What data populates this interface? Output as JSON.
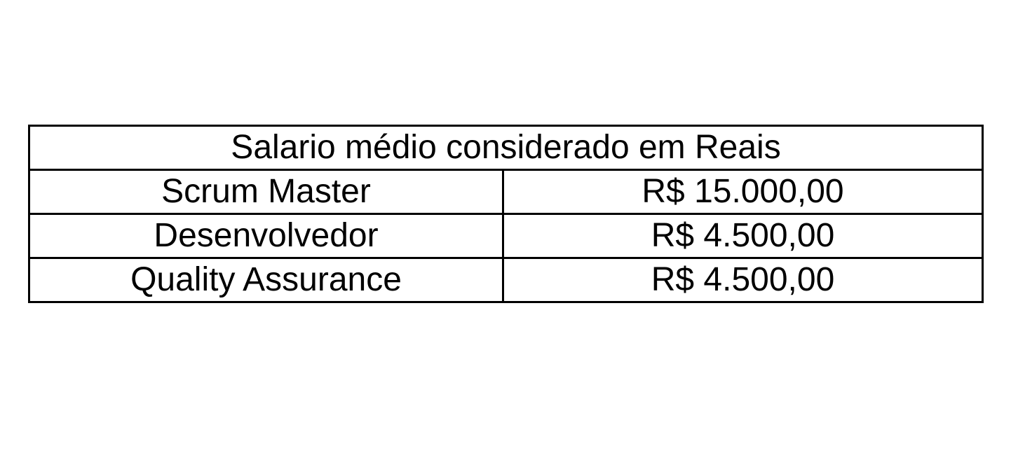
{
  "table": {
    "title": "Salario médio considerado em Reais",
    "rows": [
      {
        "role": "Scrum Master",
        "salary": "R$ 15.000,00"
      },
      {
        "role": "Desenvolvedor",
        "salary": "R$ 4.500,00"
      },
      {
        "role": "Quality Assurance",
        "salary": "R$ 4.500,00"
      }
    ]
  }
}
